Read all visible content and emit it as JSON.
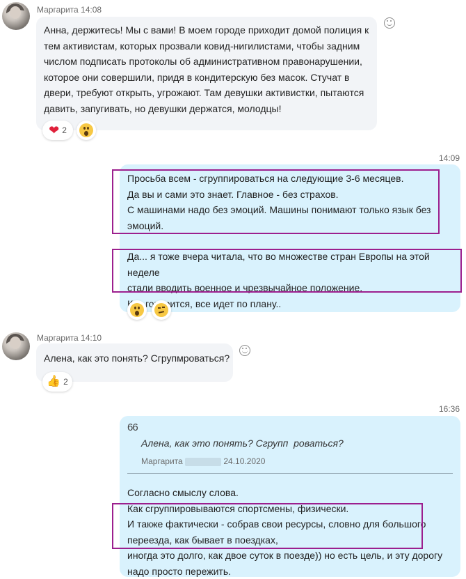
{
  "messages": [
    {
      "sender": "Маргарита",
      "time": "14:08",
      "text": "Анна, держитесь! Мы с вами! В моем городе приходит домой полиция к\nтем активистам, которых прозвали ковид-нигилистами, чтобы задним\nчислом подписать протоколы об административном правонарушении,\nкоторое они совершили, придя в кондитерскую без масок. Стучат в\nдвери, требуют открыть, угрожают. Там девушки активистки, пытаются\nдавить, запугивать, но девушки держатся, молодцы!",
      "reactions": [
        {
          "icon": "heart-icon",
          "count": "2"
        },
        {
          "icon": "surprised-emoji-icon",
          "count": ""
        }
      ]
    },
    {
      "time": "14:09",
      "text_a": "Просьба всем - сгруппироваться на следующие 3-6 месяцев.\nДа вы и сами это знает. Главное - без страхов.\nС машинами надо без эмоций. Машины понимают только язык без\nэмоций.",
      "text_b": "Да... я тоже вчера читала, что во множестве стран Европы на этой неделе\nстали вводить военное и чрезвычайное положение.\nКак говорится, все идет по плану..",
      "reactions": [
        {
          "icon": "surprised-emoji-icon"
        },
        {
          "icon": "thinking-emoji-icon"
        }
      ]
    },
    {
      "sender": "Маргарита",
      "time": "14:10",
      "text": "Алена, как это понять? Сгрупмроваться?",
      "reactions": [
        {
          "icon": "thumbs-up-icon",
          "count": "2"
        }
      ]
    },
    {
      "time": "16:36",
      "quote_mark": "66",
      "quote_text": "Алена, как это понять? Сгрупп  роваться?",
      "quote_author": "Маргарита",
      "quote_date": "24.10.2020",
      "text": "Согласно смыслу слова.\nКак сгруппировываются спортсмены, физически.\nИ также фактически - собрав свои ресурсы, словно для большого\nпереезда, как бывает в поездках,\nиногда это долго, как двое суток в поезде)) но есть цель, и эту дорогу\nнадо просто пережить."
    }
  ]
}
